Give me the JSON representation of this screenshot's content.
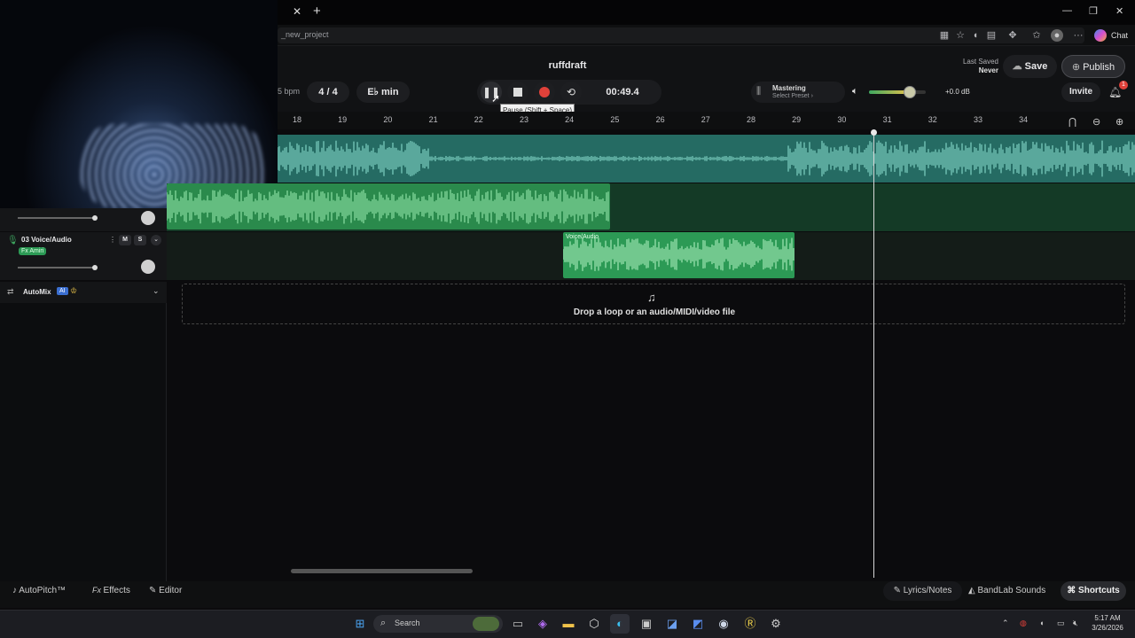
{
  "browser": {
    "address": "_new_project",
    "chat_label": "Chat",
    "window_controls": [
      "—",
      "❐",
      "✕"
    ]
  },
  "header": {
    "project_title": "ruffdraft",
    "last_saved_label": "Last Saved",
    "last_saved_value": "Never",
    "save_label": "Save",
    "publish_label": "Publish",
    "invite_label": "Invite",
    "notifications_count": "1",
    "bpm_label": "5 bpm",
    "time_signature": "4 / 4",
    "key_label": "E♭ min",
    "time_display": "00:49.4",
    "tooltip": "Pause (Shift + Space)",
    "mastering_title": "Mastering",
    "mastering_preset": "Select Preset ›",
    "master_gain": "+0.0 dB",
    "master_volume_level": 0.72
  },
  "ruler": {
    "bars": [
      "18",
      "19",
      "20",
      "21",
      "22",
      "23",
      "24",
      "25",
      "26",
      "27",
      "28",
      "29",
      "30",
      "31",
      "32",
      "33",
      "34"
    ]
  },
  "tracks": [
    {
      "name": "03 Voice/Audio",
      "fx": "Fx Amiri",
      "mute": "M",
      "solo": "S",
      "clip_label": "Voice/Audio"
    }
  ],
  "automix": {
    "label": "AutoMix",
    "badge": "AI"
  },
  "dropzone": {
    "text": "Drop a loop or an audio/MIDI/video file"
  },
  "bottom": {
    "autopitch": "AutoPitch™",
    "effects": "Effects",
    "editor": "Editor",
    "lyrics": "Lyrics/Notes",
    "sounds": "BandLab Sounds",
    "shortcuts": "Shortcuts"
  },
  "taskbar": {
    "search_label": "Search",
    "time": "5:17 AM",
    "date": "3/26/2026"
  },
  "colors": {
    "teal_clip": "#2f9b8c",
    "green_clip": "#3ea860",
    "record": "#e0413a",
    "accent_volume": "#e8c24a"
  }
}
